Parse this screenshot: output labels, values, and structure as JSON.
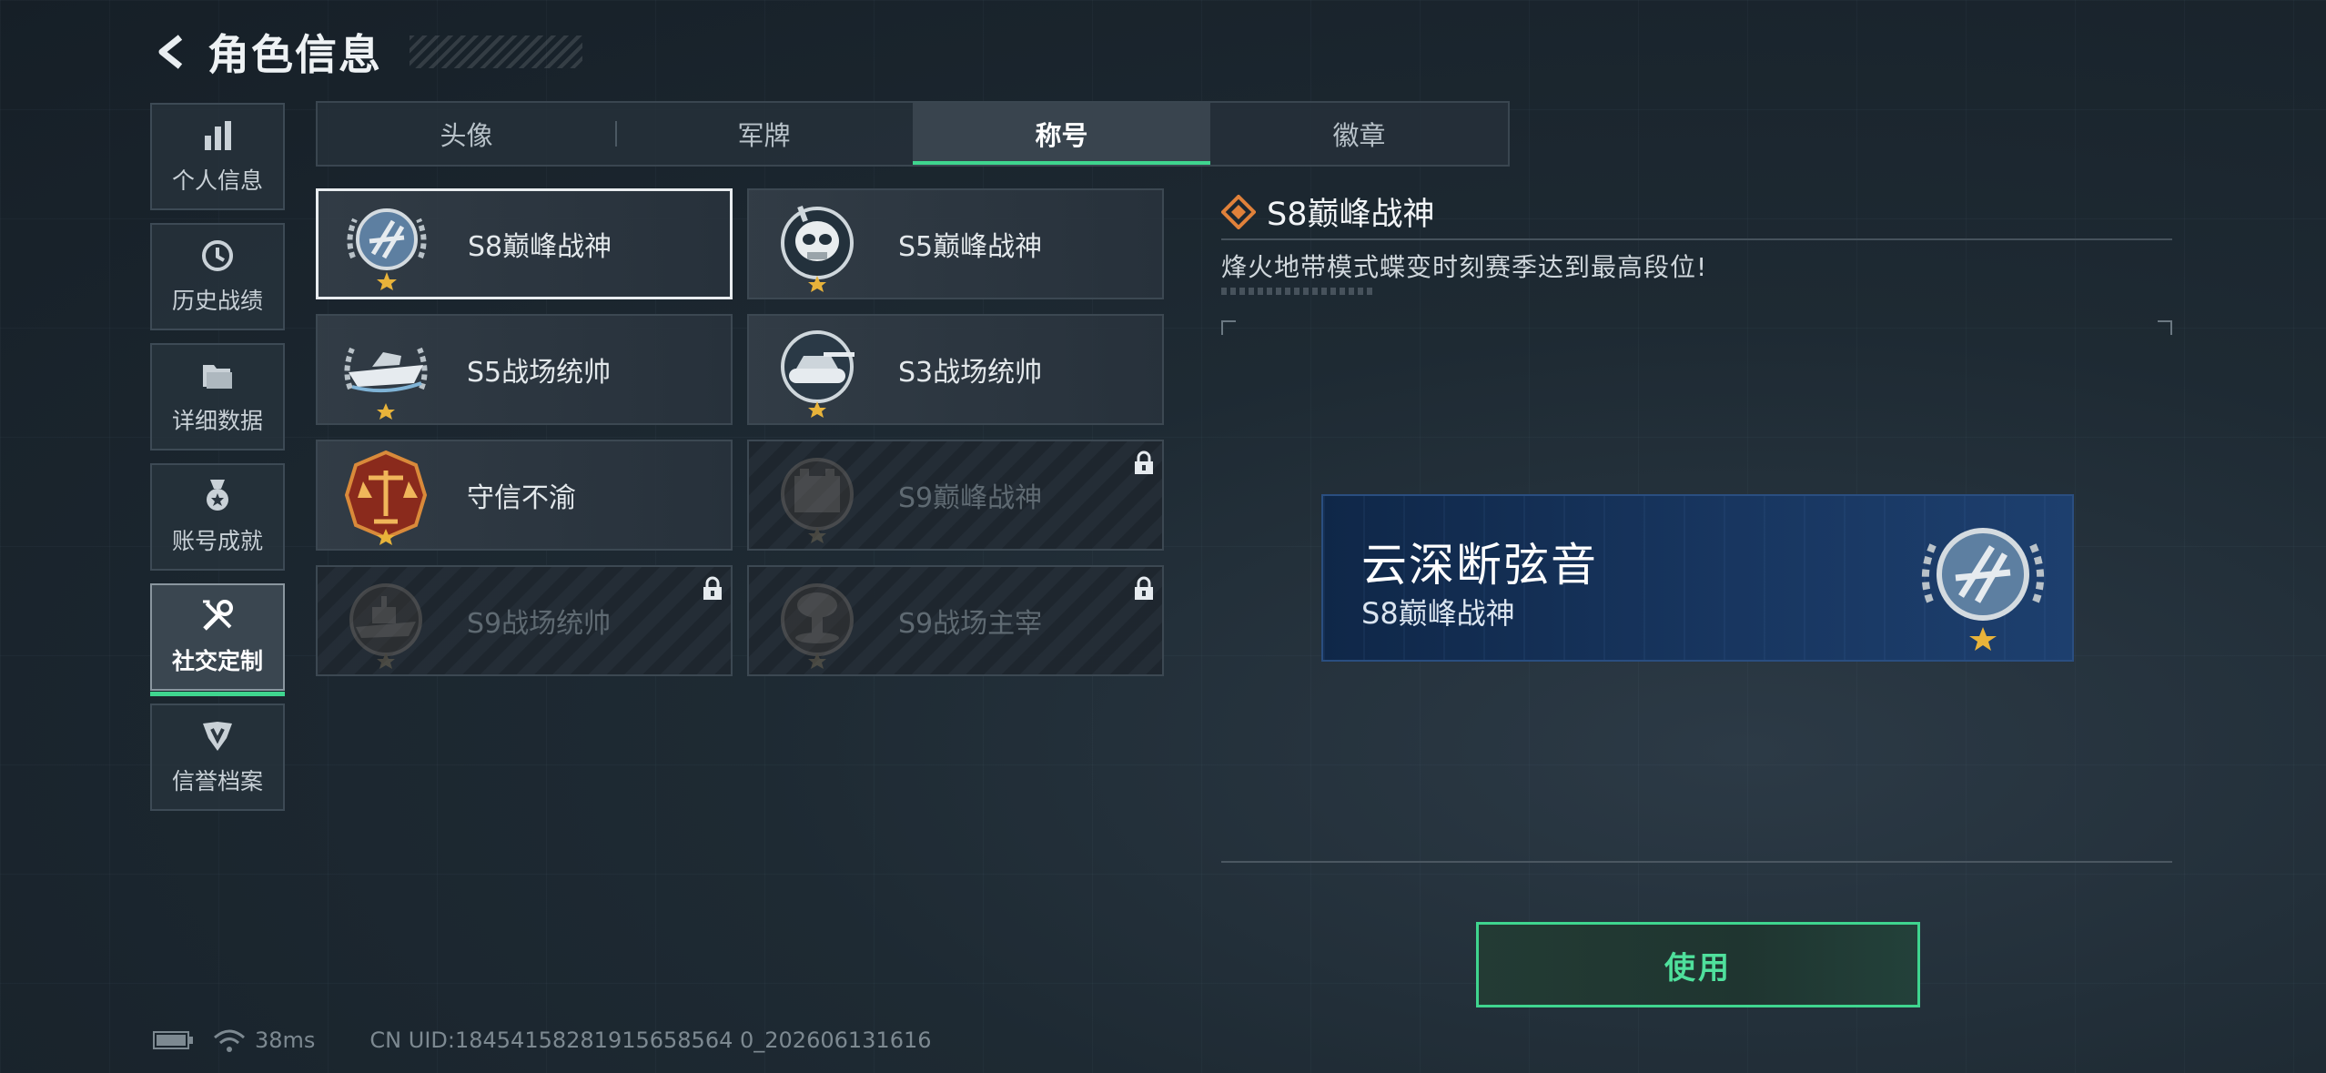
{
  "header": {
    "title": "角色信息"
  },
  "sidenav": {
    "items": [
      {
        "label": "个人信息",
        "icon": "bar-chart-icon",
        "active": false
      },
      {
        "label": "历史战绩",
        "icon": "clock-icon",
        "active": false
      },
      {
        "label": "详细数据",
        "icon": "folder-icon",
        "active": false
      },
      {
        "label": "账号成就",
        "icon": "medal-icon",
        "active": false
      },
      {
        "label": "社交定制",
        "icon": "tools-icon",
        "active": true
      },
      {
        "label": "信誉档案",
        "icon": "shield-wing-icon",
        "active": false
      }
    ]
  },
  "tabs": [
    {
      "label": "头像",
      "active": false
    },
    {
      "label": "军牌",
      "active": false
    },
    {
      "label": "称号",
      "active": true
    },
    {
      "label": "徽章",
      "active": false
    }
  ],
  "titles": [
    {
      "label": "S8巅峰战神",
      "badge": "peak-god-badge-icon",
      "selected": true,
      "locked": false
    },
    {
      "label": "S5巅峰战神",
      "badge": "skull-diver-badge-icon",
      "selected": false,
      "locked": false
    },
    {
      "label": "S5战场统帅",
      "badge": "boat-badge-icon",
      "selected": false,
      "locked": false
    },
    {
      "label": "S3战场统帅",
      "badge": "tank-badge-icon",
      "selected": false,
      "locked": false
    },
    {
      "label": "守信不渝",
      "badge": "scales-badge-icon",
      "selected": false,
      "locked": false
    },
    {
      "label": "S9巅峰战神",
      "badge": "fortress-badge-icon",
      "selected": false,
      "locked": true
    },
    {
      "label": "S9战场统帅",
      "badge": "warship-badge-icon",
      "selected": false,
      "locked": true
    },
    {
      "label": "S9战场主宰",
      "badge": "mushroom-cloud-badge-icon",
      "selected": false,
      "locked": true
    }
  ],
  "detail": {
    "title": "S8巅峰战神",
    "description": "烽火地带模式蝶变时刻赛季达到最高段位!"
  },
  "nameplate": {
    "player_name": "云深断弦音",
    "title": "S8巅峰战神"
  },
  "use_button": {
    "label": "使用"
  },
  "status": {
    "ping": "38ms",
    "uid": "CN UID:18454158281915658564 0_202606131616"
  },
  "colors": {
    "accent_green": "#3fd58f",
    "accent_orange": "#e0813a",
    "nameplate_blue": "#183660"
  }
}
